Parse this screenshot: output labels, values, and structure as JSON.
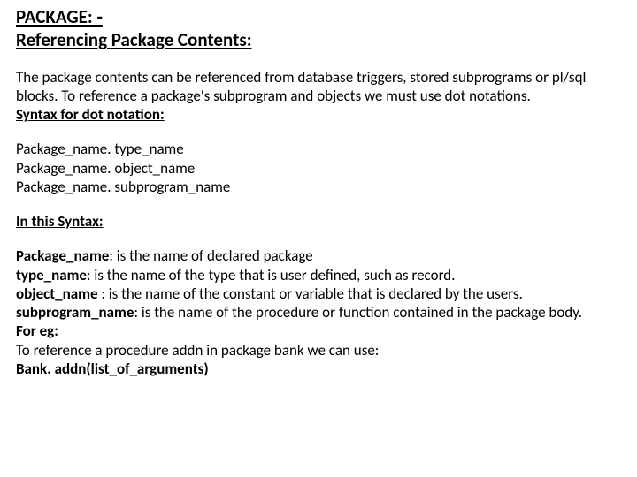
{
  "title": {
    "line1": "PACKAGE: -",
    "line2": "Referencing Package Contents:"
  },
  "intro": "The package contents can be referenced from database triggers, stored subprograms or pl/sql blocks. To reference a package's subprogram and objects we must use dot notations.",
  "syntax_heading": "Syntax for dot notation:",
  "syntax_lines": {
    "l1": "Package_name. type_name",
    "l2": "Package_name. object_name",
    "l3": "Package_name. subprogram_name"
  },
  "in_this_syntax_heading": "In this Syntax:",
  "defs": {
    "package_name_label": "Package_name",
    "package_name_desc": ": is the name of declared package",
    "type_name_label": "type_name",
    "type_name_desc": ": is the name of the type that is user defined, such as record.",
    "object_name_label": "object_name",
    "object_name_desc": " : is the name of the constant or variable that is declared by the users.",
    "subprogram_name_label": "subprogram_name",
    "subprogram_name_desc": ": is the name of the procedure or function contained in the package body."
  },
  "for_eg_label": "For eg:",
  "for_eg_line": "To reference a procedure addn in package bank we can use:",
  "example_call": "Bank. addn(list_of_arguments)"
}
